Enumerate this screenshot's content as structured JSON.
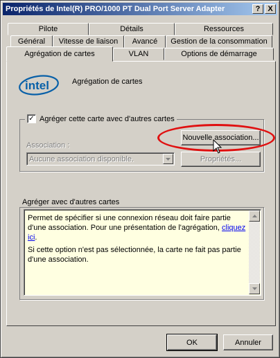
{
  "window": {
    "title": "Propriétés de Intel(R) PRO/1000 PT Dual Port Server Adapter",
    "help_button": "?",
    "close_button": "X"
  },
  "tabs": {
    "row1": [
      "Pilote",
      "Détails",
      "Ressources"
    ],
    "row2": [
      "Général",
      "Vitesse de liaison",
      "Avancé",
      "Gestion de la consommation"
    ],
    "row3": [
      "Agrégation de cartes",
      "VLAN",
      "Options de démarrage"
    ],
    "active": "Agrégation de cartes"
  },
  "header": {
    "logo_text": "intel",
    "heading": "Agrégation de cartes"
  },
  "group": {
    "checkbox_label": "Agréger cette carte avec d'autres cartes",
    "checkbox_checked": true,
    "new_team_button": "Nouvelle association...",
    "team_label": "Association :",
    "team_combo_value": "Aucune association disponible.",
    "properties_button": "Propriétés..."
  },
  "description": {
    "title": "Agréger avec d'autres cartes",
    "para1_before_link": "Permet de spécifier si une connexion réseau doit faire partie d'une association. Pour une présentation de l'agrégation, ",
    "link_text": "cliquez ici",
    "para1_after_link": ".",
    "para2": "Si cette option n'est pas sélectionnée, la carte ne fait pas partie d'une association."
  },
  "footer": {
    "ok_button": "OK",
    "cancel_button": "Annuler"
  },
  "colors": {
    "title_gradient_start": "#0a246a",
    "title_gradient_end": "#a6caf0",
    "face": "#d4d0c8",
    "info_background": "#ffffe1",
    "highlight_ellipse": "#e01010",
    "intel_blue": "#0860a8"
  }
}
